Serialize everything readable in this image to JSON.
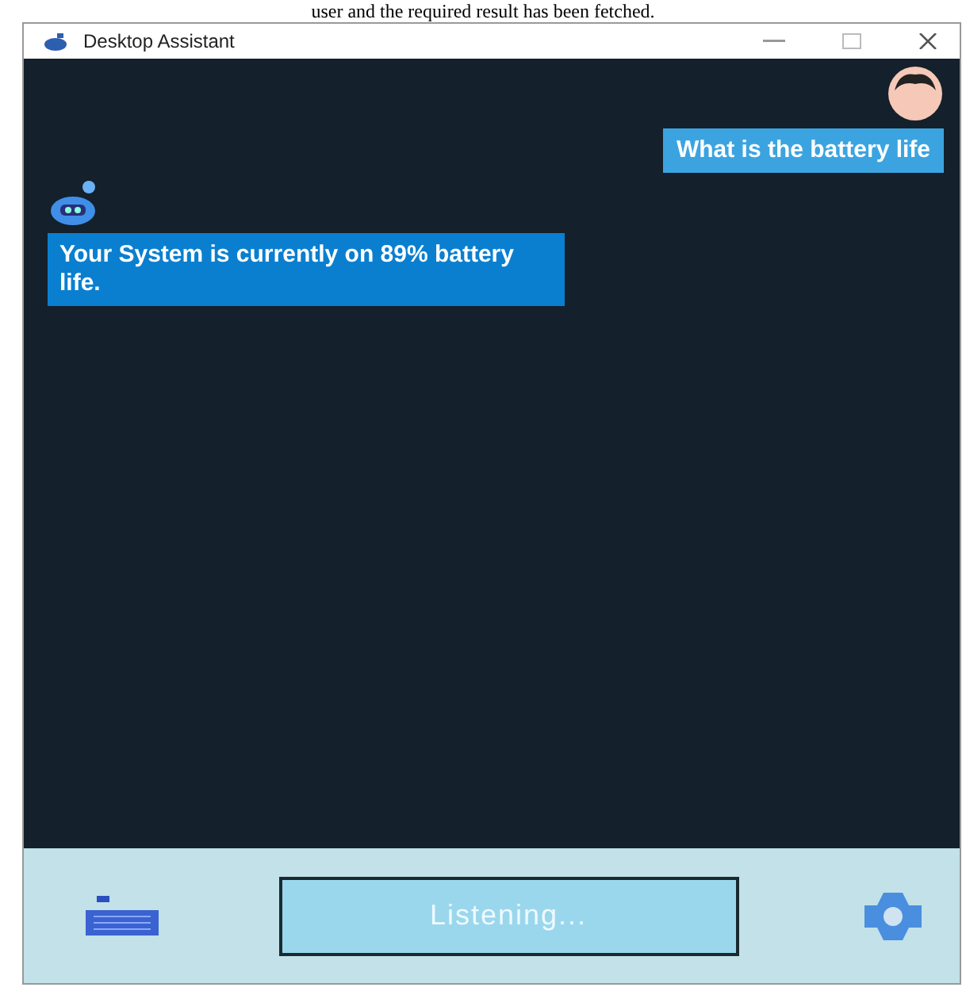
{
  "caption": "user and the required result has been fetched.",
  "window": {
    "title": "Desktop Assistant"
  },
  "messages": [
    {
      "kind": "user",
      "text": "What is the battery life"
    },
    {
      "kind": "bot",
      "text": "Your System is currently on 89% battery life."
    }
  ],
  "status": {
    "label": "Listening..."
  }
}
